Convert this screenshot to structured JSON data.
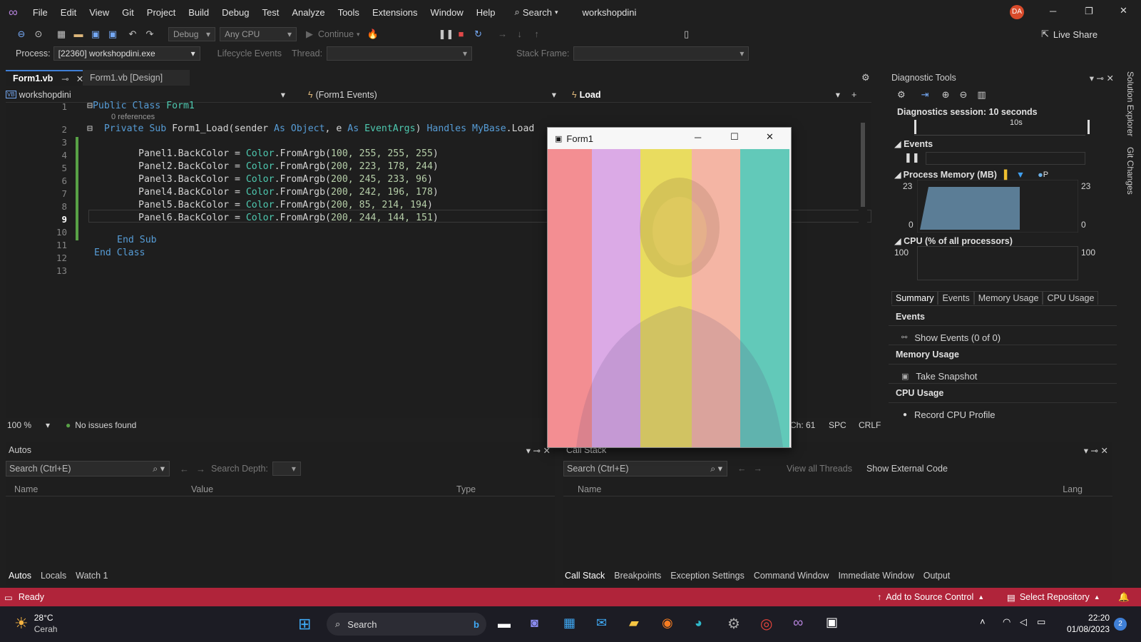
{
  "app": {
    "search_label": "Search",
    "solution_name": "workshopdini",
    "user_initials": "DA",
    "live_share": "Live Share"
  },
  "menu": [
    "File",
    "Edit",
    "View",
    "Git",
    "Project",
    "Build",
    "Debug",
    "Test",
    "Analyze",
    "Tools",
    "Extensions",
    "Window",
    "Help"
  ],
  "toolbar": {
    "config": "Debug",
    "platform": "Any CPU",
    "continue": "Continue"
  },
  "toolbar2": {
    "process_label": "Process:",
    "process_value": "[22360] workshopdini.exe",
    "lifecycle": "Lifecycle Events",
    "thread_label": "Thread:",
    "stack_frame_label": "Stack Frame:"
  },
  "tabs": {
    "active": "Form1.vb",
    "inactive": "Form1.vb [Design]"
  },
  "nav": {
    "project": "workshopdini",
    "events": "(Form1 Events)",
    "method": "Load"
  },
  "code": {
    "line_numbers": [
      "1",
      "2",
      "3",
      "4",
      "5",
      "6",
      "7",
      "8",
      "9",
      "10",
      "11",
      "12",
      "13"
    ],
    "refs": "0 references",
    "l1": [
      "Public Class ",
      "Form1"
    ],
    "l2": [
      "Private Sub ",
      "Form1_Load",
      "(sender ",
      "As ",
      "Object",
      ", e ",
      "As ",
      "EventArgs",
      ") ",
      "Handles ",
      "MyBase",
      ".Load"
    ],
    "panels": [
      {
        "name": "Panel1",
        "args": "100, 255, 255, 255"
      },
      {
        "name": "Panel2",
        "args": "200, 223, 178, 244"
      },
      {
        "name": "Panel3",
        "args": "200, 245, 233, 96"
      },
      {
        "name": "Panel4",
        "args": "200, 242, 196, 178"
      },
      {
        "name": "Panel5",
        "args": "200, 85, 214, 194"
      },
      {
        "name": "Panel6",
        "args": "200, 244, 144, 151"
      }
    ],
    "backcolor": ".BackColor = ",
    "color": "Color",
    ".fromargb": ".FromArgb(",
    "endsub": "End Sub",
    "endclass": "End Class"
  },
  "editor_status": {
    "zoom": "100 %",
    "issues": "No issues found",
    "ch": "Ch: 61",
    "spc": "SPC",
    "crlf": "CRLF"
  },
  "diag": {
    "title": "Diagnostic Tools",
    "session": "Diagnostics session: 10 seconds",
    "tick": "10s",
    "events": "Events",
    "memory": "Process Memory (MB)",
    "mem_max": "23",
    "mem_min": "0",
    "legend_p": "P",
    "cpu": "CPU (% of all processors)",
    "cpu_max": "100",
    "tabs": [
      "Summary",
      "Events",
      "Memory Usage",
      "CPU Usage"
    ],
    "sec_events": "Events",
    "show_events": "Show Events (0 of 0)",
    "sec_memory": "Memory Usage",
    "take_snapshot": "Take Snapshot",
    "sec_cpu": "CPU Usage",
    "record_cpu": "Record CPU Profile"
  },
  "autos": {
    "title": "Autos",
    "search": "Search (Ctrl+E)",
    "depth": "Search Depth:",
    "cols": [
      "Name",
      "Value",
      "Type"
    ],
    "tabs": [
      "Autos",
      "Locals",
      "Watch 1"
    ]
  },
  "callstack": {
    "title": "Call Stack",
    "search": "Search (Ctrl+E)",
    "view_threads": "View all Threads",
    "external": "Show External Code",
    "cols": [
      "Name",
      "Lang"
    ],
    "tabs": [
      "Call Stack",
      "Breakpoints",
      "Exception Settings",
      "Command Window",
      "Immediate Window",
      "Output"
    ]
  },
  "status": {
    "ready": "Ready",
    "source_control": "Add to Source Control",
    "repo": "Select Repository"
  },
  "taskbar": {
    "temp": "28°C",
    "weather": "Cerah",
    "search": "Search",
    "time": "22:20",
    "date": "01/08/2023",
    "notif": "2"
  },
  "form": {
    "title": "Form1",
    "panel_colors": [
      "#f38e92",
      "#dbaae6",
      "#e9dc5f",
      "#f4b5a4",
      "#62c9b9",
      "#f38e92"
    ]
  },
  "side": {
    "solution_explorer": "Solution Explorer",
    "git_changes": "Git Changes"
  }
}
